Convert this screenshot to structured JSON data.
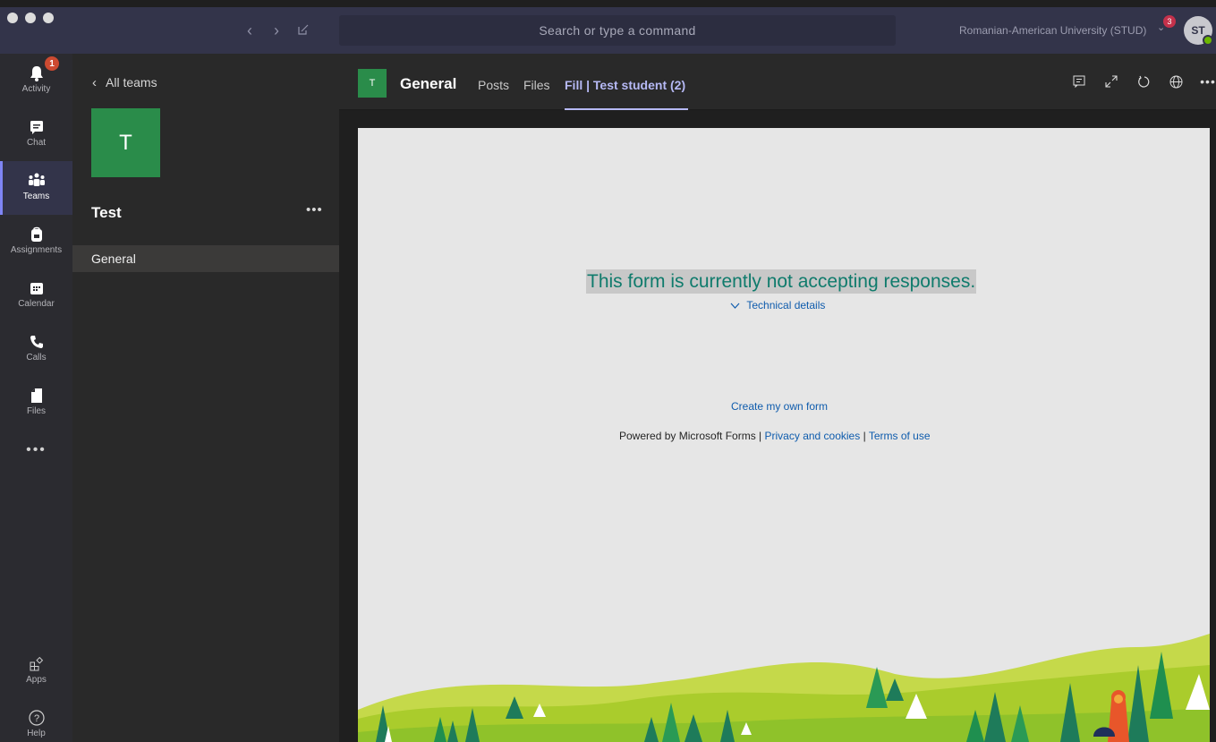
{
  "topbar": {
    "search_placeholder": "Search or type a command",
    "org_name": "Romanian-American University (STUD)",
    "org_badge": "3",
    "avatar_initials": "ST"
  },
  "rail": {
    "items": [
      {
        "label": "Activity",
        "icon": "bell-icon",
        "badge": "1"
      },
      {
        "label": "Chat",
        "icon": "chat-icon"
      },
      {
        "label": "Teams",
        "icon": "teams-icon",
        "active": true
      },
      {
        "label": "Assignments",
        "icon": "backpack-icon"
      },
      {
        "label": "Calendar",
        "icon": "calendar-icon"
      },
      {
        "label": "Calls",
        "icon": "phone-icon"
      },
      {
        "label": "Files",
        "icon": "file-icon"
      }
    ],
    "more_label": "•••",
    "apps_label": "Apps",
    "help_label": "Help"
  },
  "panel": {
    "back_label": "All teams",
    "team_initial": "T",
    "team_name": "Test",
    "more_label": "•••",
    "channels": [
      "General"
    ]
  },
  "channel_header": {
    "tile_initial": "T",
    "name": "General",
    "tabs": [
      {
        "label": "Posts"
      },
      {
        "label": "Files"
      },
      {
        "label": "Fill | Test student (2)",
        "active": true
      }
    ]
  },
  "form": {
    "message": "This form is currently not accepting responses.",
    "technical_details": "Technical details",
    "create_link": "Create my own form",
    "powered_by": "Powered by Microsoft Forms |",
    "privacy_link": "Privacy and cookies",
    "separator": "|",
    "terms_link": "Terms of use"
  },
  "colors": {
    "topbar": "#33344a",
    "team_green": "#2a8c4a",
    "form_message": "#0f7b6c",
    "link": "#0f5cad",
    "accent": "#b6b9f5"
  }
}
